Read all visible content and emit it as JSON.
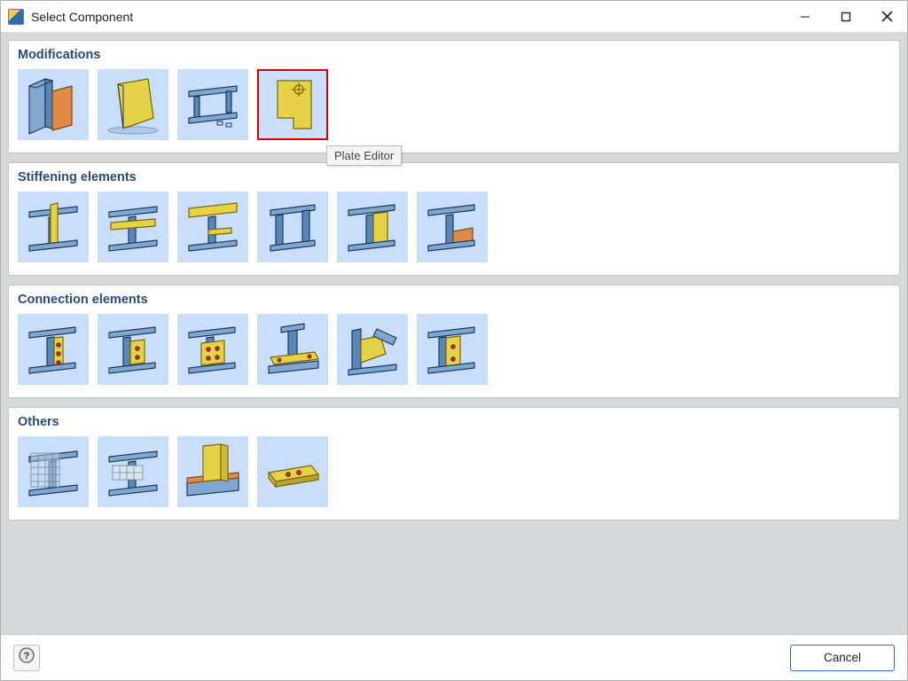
{
  "window": {
    "title": "Select Component"
  },
  "groups": [
    {
      "title": "Modifications",
      "items": [
        {
          "name": "mod-cut-member",
          "selected": false
        },
        {
          "name": "mod-plate",
          "selected": false
        },
        {
          "name": "mod-section-cut",
          "selected": false
        },
        {
          "name": "mod-plate-editor",
          "selected": true,
          "tooltip": "Plate Editor"
        }
      ]
    },
    {
      "title": "Stiffening elements",
      "items": [
        {
          "name": "stiff-rib",
          "selected": false
        },
        {
          "name": "stiff-web-plate",
          "selected": false
        },
        {
          "name": "stiff-widener",
          "selected": false
        },
        {
          "name": "stiff-channel",
          "selected": false
        },
        {
          "name": "stiff-doubler",
          "selected": false
        },
        {
          "name": "stiff-haunch",
          "selected": false
        }
      ]
    },
    {
      "title": "Connection elements",
      "items": [
        {
          "name": "conn-end-plate",
          "selected": false
        },
        {
          "name": "conn-shear-tab",
          "selected": false
        },
        {
          "name": "conn-splice",
          "selected": false
        },
        {
          "name": "conn-base-plate",
          "selected": false
        },
        {
          "name": "conn-gusset",
          "selected": false
        },
        {
          "name": "conn-angle",
          "selected": false
        }
      ]
    },
    {
      "title": "Others",
      "items": [
        {
          "name": "other-grid",
          "selected": false
        },
        {
          "name": "other-block",
          "selected": false
        },
        {
          "name": "other-weld",
          "selected": false
        },
        {
          "name": "other-footing",
          "selected": false
        }
      ]
    }
  ],
  "footer": {
    "help_label": "?",
    "cancel_label": "Cancel"
  }
}
